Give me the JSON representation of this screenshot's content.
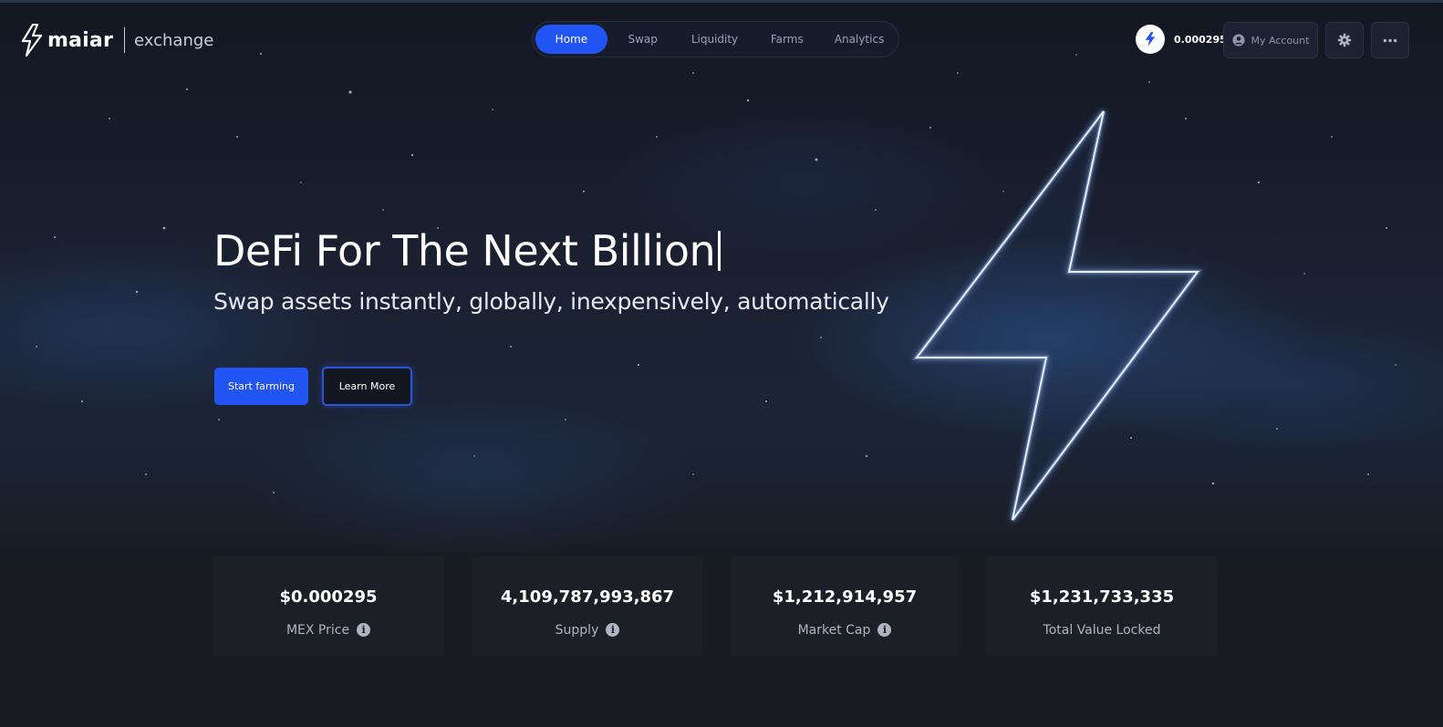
{
  "brand": {
    "name": "maiar",
    "subtitle": "exchange"
  },
  "nav": {
    "items": [
      {
        "label": "Home",
        "active": true
      },
      {
        "label": "Swap",
        "active": false
      },
      {
        "label": "Liquidity",
        "active": false
      },
      {
        "label": "Farms",
        "active": false
      },
      {
        "label": "Analytics",
        "active": false
      }
    ]
  },
  "header": {
    "mex_price": "0.000295",
    "account_label": "My Account",
    "icons": {
      "token": "lightning-bolt-icon",
      "account": "user-circle-icon",
      "settings": "gear-icon",
      "more": "more-dots-icon"
    }
  },
  "hero": {
    "title": "DeFi For The Next Billion",
    "subtitle": "Swap assets instantly, globally, inexpensively, automatically",
    "primary_button": "Start farming",
    "secondary_button": "Learn More"
  },
  "stats": [
    {
      "value": "$0.000295",
      "label": "MEX Price",
      "info": true
    },
    {
      "value": "4,109,787,993,867",
      "label": "Supply",
      "info": true
    },
    {
      "value": "$1,212,914,957",
      "label": "Market Cap",
      "info": true
    },
    {
      "value": "$1,231,733,335",
      "label": "Total Value Locked",
      "info": false
    }
  ],
  "colors": {
    "accent": "#2355f5",
    "background": "#181b22",
    "muted_text": "#aeb4c2"
  }
}
